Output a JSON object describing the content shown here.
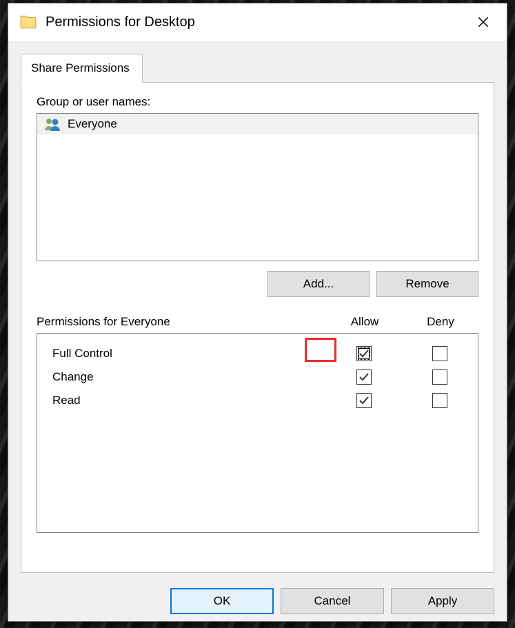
{
  "window": {
    "title": "Permissions for Desktop"
  },
  "tab": {
    "label": "Share Permissions"
  },
  "groups": {
    "label": "Group or user names:",
    "items": [
      {
        "name": "Everyone"
      }
    ],
    "add_label": "Add...",
    "remove_label": "Remove"
  },
  "permissions": {
    "title": "Permissions for Everyone",
    "allow_header": "Allow",
    "deny_header": "Deny",
    "rows": [
      {
        "name": "Full Control",
        "allow": true,
        "deny": false,
        "focused": true
      },
      {
        "name": "Change",
        "allow": true,
        "deny": false,
        "focused": false
      },
      {
        "name": "Read",
        "allow": true,
        "deny": false,
        "focused": false
      }
    ]
  },
  "footer": {
    "ok": "OK",
    "cancel": "Cancel",
    "apply": "Apply"
  }
}
